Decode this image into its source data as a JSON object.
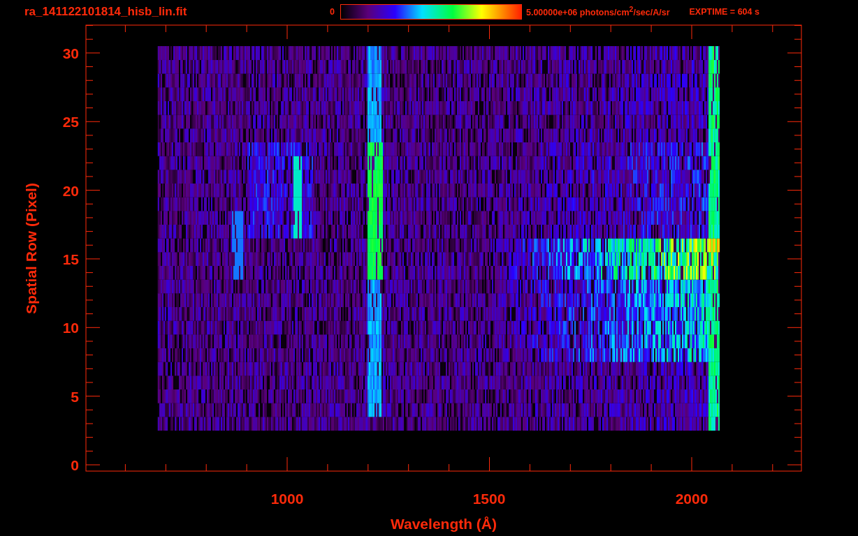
{
  "header": {
    "filename": "ra_141122101814_hisb_lin.fit",
    "colorbar_min": "0",
    "colorbar_max": "5.00000e+06 photons/cm$^{2}$/sec/A/sr",
    "exposure": "EXPTIME = 604 s"
  },
  "plot": {
    "xlabel": "Wavelength (Å)",
    "ylabel": "Spatial Row (Pixel)",
    "xticks": [
      "1000",
      "1500",
      "2000"
    ],
    "yticks": [
      "30",
      "25",
      "20",
      "15",
      "10",
      "5",
      "0"
    ]
  }
}
